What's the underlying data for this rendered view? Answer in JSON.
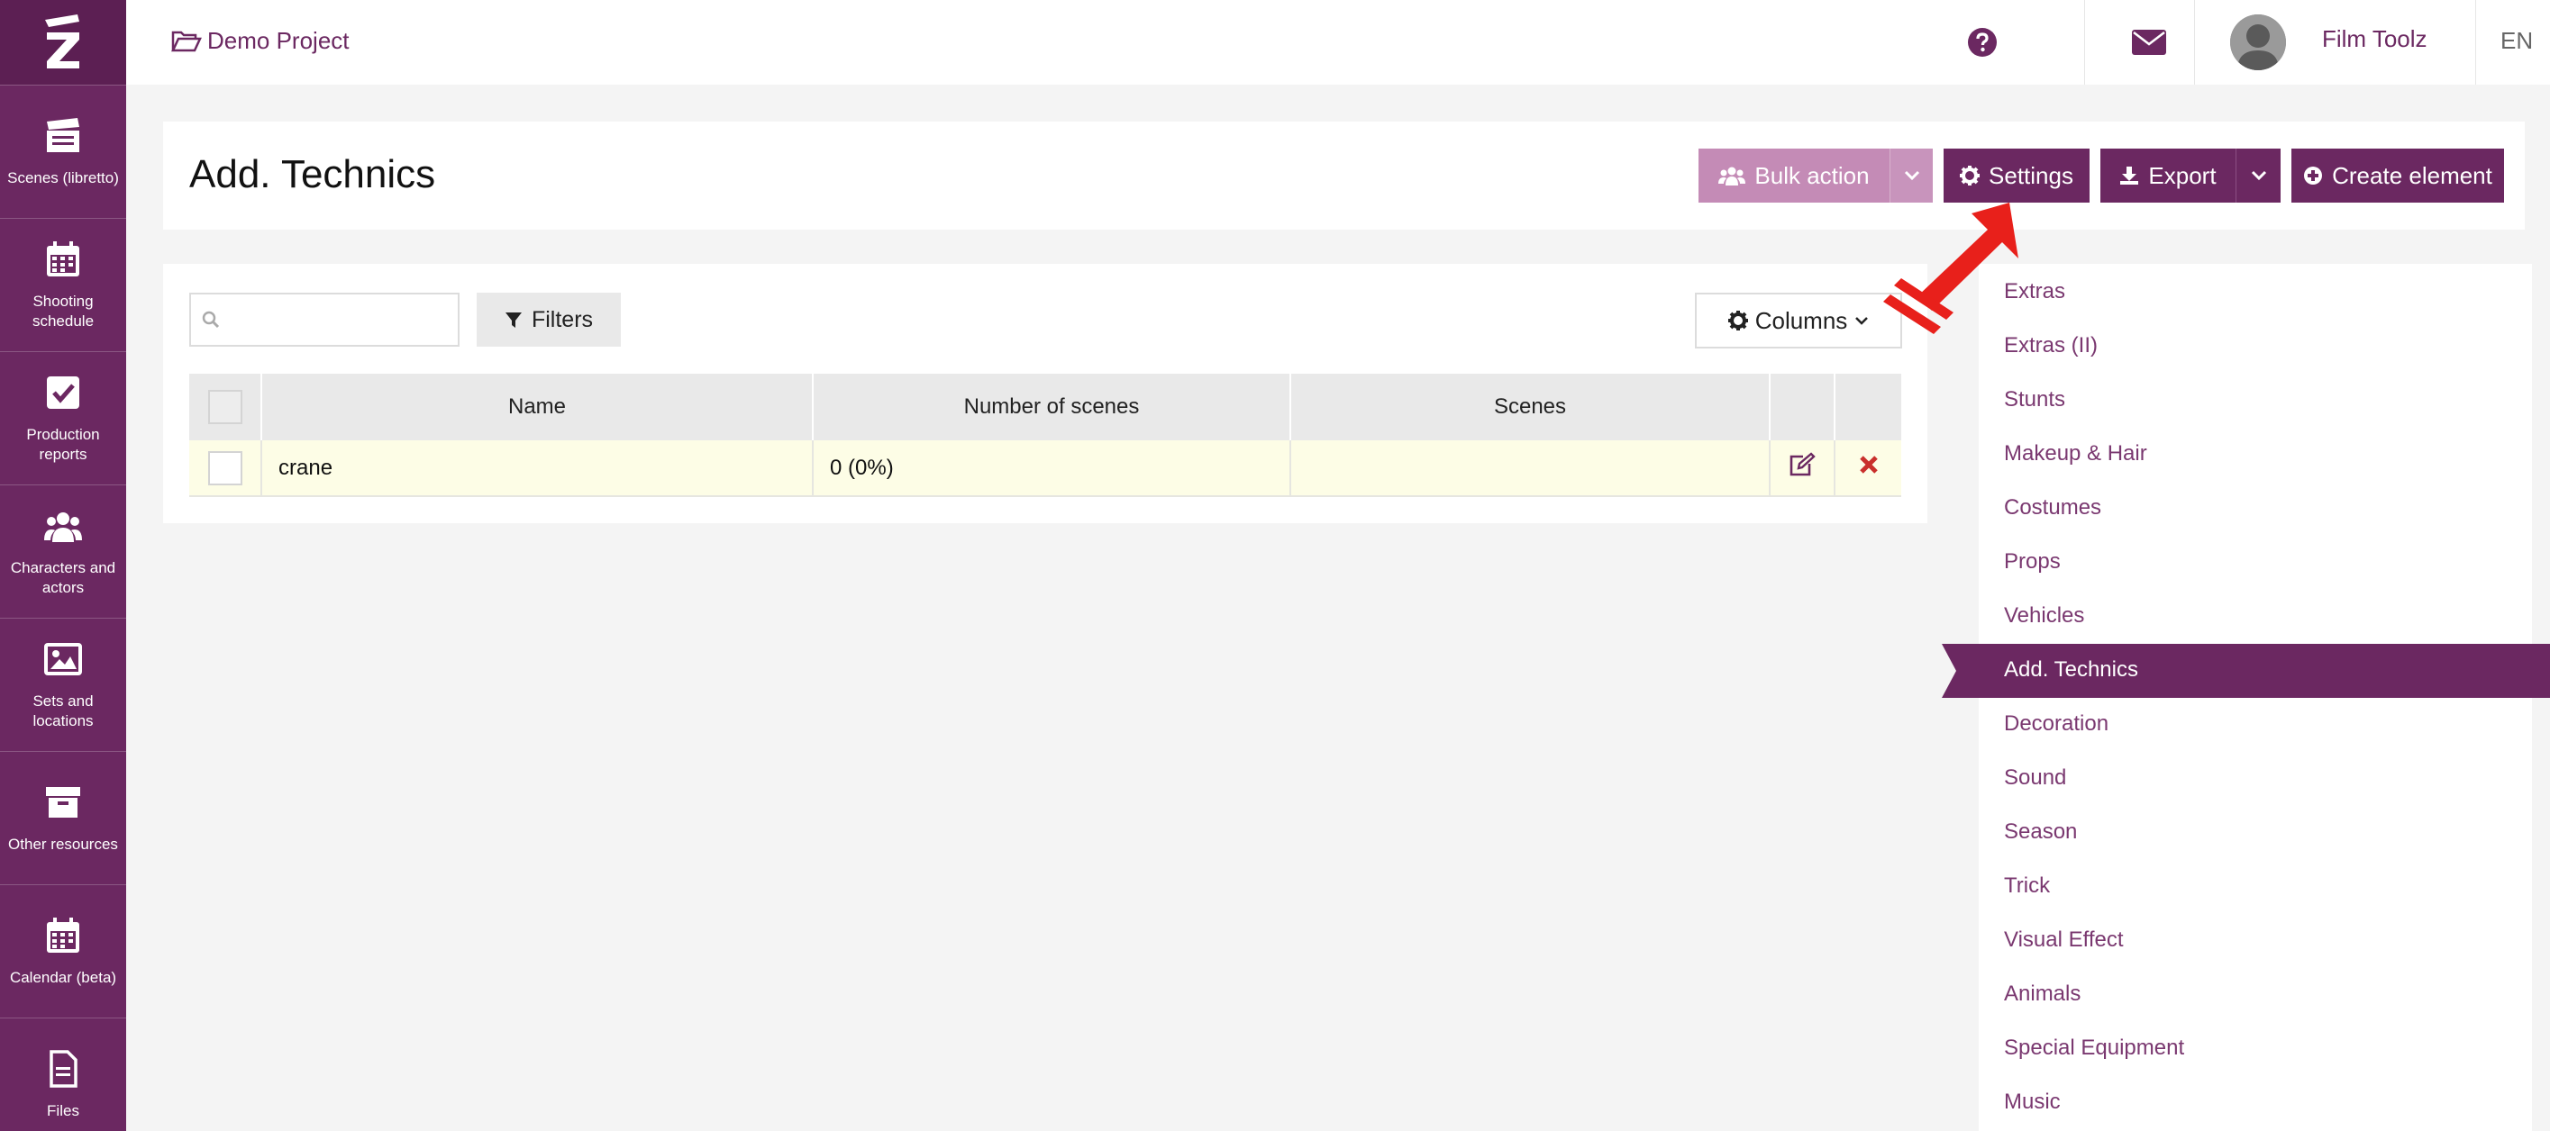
{
  "app": {
    "project_name": "Demo Project",
    "user_name": "Film Toolz",
    "language": "EN"
  },
  "colors": {
    "brand": "#6b2861",
    "brand_light": "#c48bb6",
    "danger": "#c9302c",
    "row_highlight": "#fdfde6"
  },
  "sidebar": {
    "items": [
      {
        "label": "Scenes (libretto)",
        "icon": "clapperboard-icon"
      },
      {
        "label": "Shooting schedule",
        "icon": "calendar-icon"
      },
      {
        "label": "Production reports",
        "icon": "checkbox-icon"
      },
      {
        "label": "Characters and actors",
        "icon": "users-icon"
      },
      {
        "label": "Sets and locations",
        "icon": "image-icon"
      },
      {
        "label": "Other resources",
        "icon": "archive-icon"
      },
      {
        "label": "Calendar (beta)",
        "icon": "calendar-icon"
      },
      {
        "label": "Files",
        "icon": "file-icon"
      }
    ]
  },
  "header": {
    "title": "Add. Technics",
    "bulk_action_label": "Bulk action",
    "settings_label": "Settings",
    "export_label": "Export",
    "create_label": "Create element"
  },
  "toolbar": {
    "search_placeholder": "",
    "filters_label": "Filters",
    "columns_label": "Columns"
  },
  "table": {
    "columns": [
      "Name",
      "Number of scenes",
      "Scenes"
    ],
    "rows": [
      {
        "name": "crane",
        "number_of_scenes": "0 (0%)",
        "scenes": ""
      }
    ]
  },
  "resource_menu": {
    "items": [
      "Extras",
      "Extras (II)",
      "Stunts",
      "Makeup & Hair",
      "Costumes",
      "Props",
      "Vehicles",
      "Add. Technics",
      "Decoration",
      "Sound",
      "Season",
      "Trick",
      "Visual Effect",
      "Animals",
      "Special Equipment",
      "Music"
    ],
    "active": "Add. Technics"
  }
}
